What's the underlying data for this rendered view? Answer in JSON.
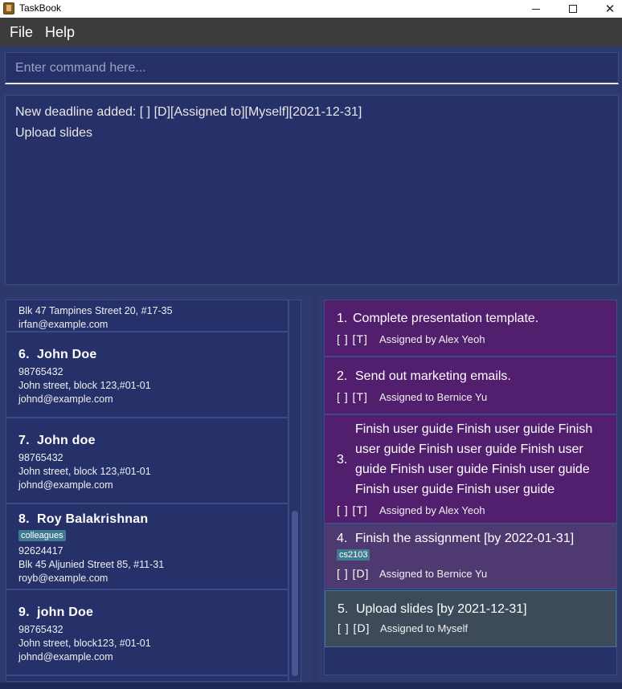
{
  "window": {
    "title": "TaskBook"
  },
  "menu": {
    "file": "File",
    "help": "Help"
  },
  "command": {
    "placeholder": "Enter command here..."
  },
  "result": {
    "line1": "New deadline added: [  ]  [D][Assigned to][Myself][2021-12-31]",
    "line2": "Upload slides"
  },
  "persons": [
    {
      "address": "Blk 47 Tampines Street 20, #17-35",
      "email": "irfan@example.com"
    },
    {
      "index": "6.",
      "name": "John Doe",
      "phone": "98765432",
      "address": "John street, block 123,#01-01",
      "email": "johnd@example.com"
    },
    {
      "index": "7.",
      "name": "John doe",
      "phone": "98765432",
      "address": "John street, block 123,#01-01",
      "email": "johnd@example.com"
    },
    {
      "index": "8.",
      "name": "Roy Balakrishnan",
      "tag": "colleagues",
      "phone": "92624417",
      "address": "Blk 45 Aljunied Street 85, #11-31",
      "email": "royb@example.com"
    },
    {
      "index": "9.",
      "name": "john Doe",
      "phone": "98765432",
      "address": "John street, block123, #01-01",
      "email": "johnd@example.com"
    }
  ],
  "tasks": [
    {
      "index": "1.",
      "title": "Complete presentation template.",
      "status": "[  ]  [T]",
      "assignment": "Assigned by  Alex Yeoh"
    },
    {
      "index": "2.",
      "title": "Send out marketing emails.",
      "status": "[  ]  [T]",
      "assignment": "Assigned to  Bernice Yu"
    },
    {
      "index": "3.",
      "title": "Finish user guide Finish user guide Finish user guide Finish user guide Finish user guide Finish user guide Finish user guide Finish user guide Finish user guide",
      "status": "[  ]  [T]",
      "assignment": "Assigned by  Alex Yeoh"
    },
    {
      "index": "4.",
      "title": "Finish the assignment [by 2022-01-31]",
      "tag": "cs2103",
      "status": "[  ]  [D]",
      "assignment": "Assigned to  Bernice Yu"
    },
    {
      "index": "5.",
      "title": "Upload slides [by 2021-12-31]",
      "status": "[  ]  [D]",
      "assignment": "Assigned to  Myself"
    }
  ],
  "colors": {
    "background": "#2e3a6e",
    "panel": "#263069",
    "task_purple": "#521f6e",
    "task_selected": "#3d4a59",
    "tag": "#3e7b91"
  }
}
